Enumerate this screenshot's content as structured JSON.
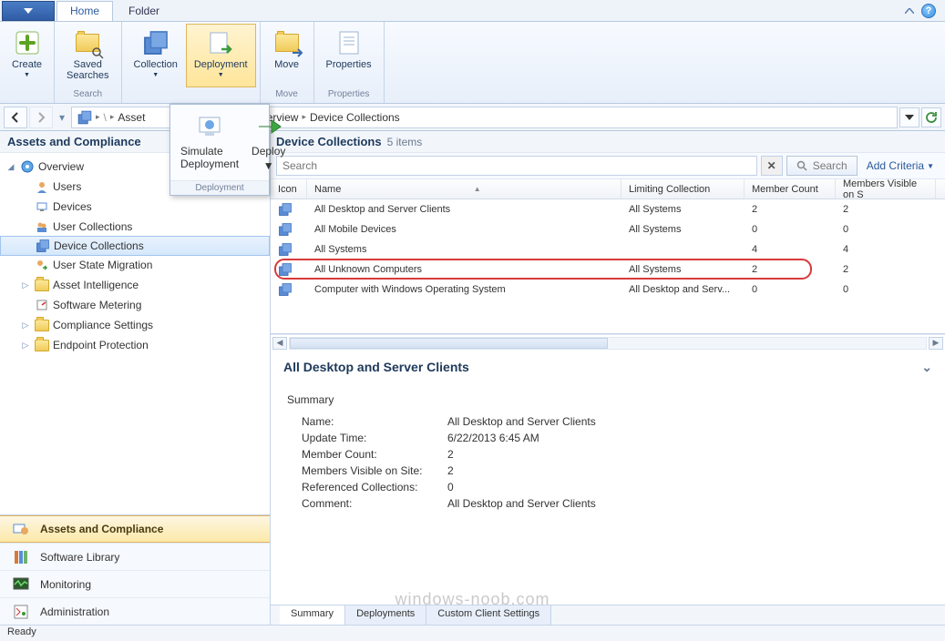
{
  "tabs": {
    "home": "Home",
    "folder": "Folder"
  },
  "ribbon": {
    "create": "Create",
    "saved_searches": "Saved\nSearches",
    "search_group": "Search",
    "collection": "Collection",
    "deployment": "Deployment",
    "move": "Move",
    "move_group": "Move",
    "properties": "Properties",
    "properties_group": "Properties"
  },
  "dropdown": {
    "simulate": "Simulate\nDeployment",
    "deploy": "Deploy",
    "group": "Deployment"
  },
  "breadcrumb": {
    "root": "Asset",
    "overview": "Overview",
    "current": "Device Collections"
  },
  "sidebar": {
    "title": "Assets and Compliance",
    "overview": "Overview",
    "users": "Users",
    "devices": "Devices",
    "user_collections": "User Collections",
    "device_collections": "Device Collections",
    "user_state_migration": "User State Migration",
    "asset_intelligence": "Asset Intelligence",
    "software_metering": "Software Metering",
    "compliance_settings": "Compliance Settings",
    "endpoint_protection": "Endpoint Protection"
  },
  "nav": {
    "assets": "Assets and Compliance",
    "software": "Software Library",
    "monitoring": "Monitoring",
    "administration": "Administration"
  },
  "content": {
    "header_name": "Device Collections",
    "header_count": "5 items",
    "search_placeholder": "Search",
    "search_btn": "Search",
    "add_criteria": "Add Criteria",
    "columns": {
      "icon": "Icon",
      "name": "Name",
      "limiting": "Limiting Collection",
      "member_count": "Member Count",
      "members_visible": "Members Visible on S"
    },
    "rows": [
      {
        "name": "All Desktop and Server Clients",
        "limiting": "All Systems",
        "count": "2",
        "visible": "2"
      },
      {
        "name": "All Mobile Devices",
        "limiting": "All Systems",
        "count": "0",
        "visible": "0"
      },
      {
        "name": "All Systems",
        "limiting": "",
        "count": "4",
        "visible": "4"
      },
      {
        "name": "All Unknown Computers",
        "limiting": "All Systems",
        "count": "2",
        "visible": "2"
      },
      {
        "name": "Computer with Windows Operating System",
        "limiting": "All Desktop and Serv...",
        "count": "0",
        "visible": "0"
      }
    ]
  },
  "detail": {
    "title": "All Desktop and Server Clients",
    "summary_label": "Summary",
    "fields": {
      "name_k": "Name:",
      "name_v": "All Desktop and Server Clients",
      "update_k": "Update Time:",
      "update_v": "6/22/2013 6:45 AM",
      "count_k": "Member Count:",
      "count_v": "2",
      "visible_k": "Members Visible on Site:",
      "visible_v": "2",
      "ref_k": "Referenced Collections:",
      "ref_v": "0",
      "comment_k": "Comment:",
      "comment_v": "All Desktop and Server Clients"
    },
    "tabs": {
      "summary": "Summary",
      "deployments": "Deployments",
      "custom": "Custom Client Settings"
    }
  },
  "status": "Ready",
  "watermark": "windows-noob.com"
}
